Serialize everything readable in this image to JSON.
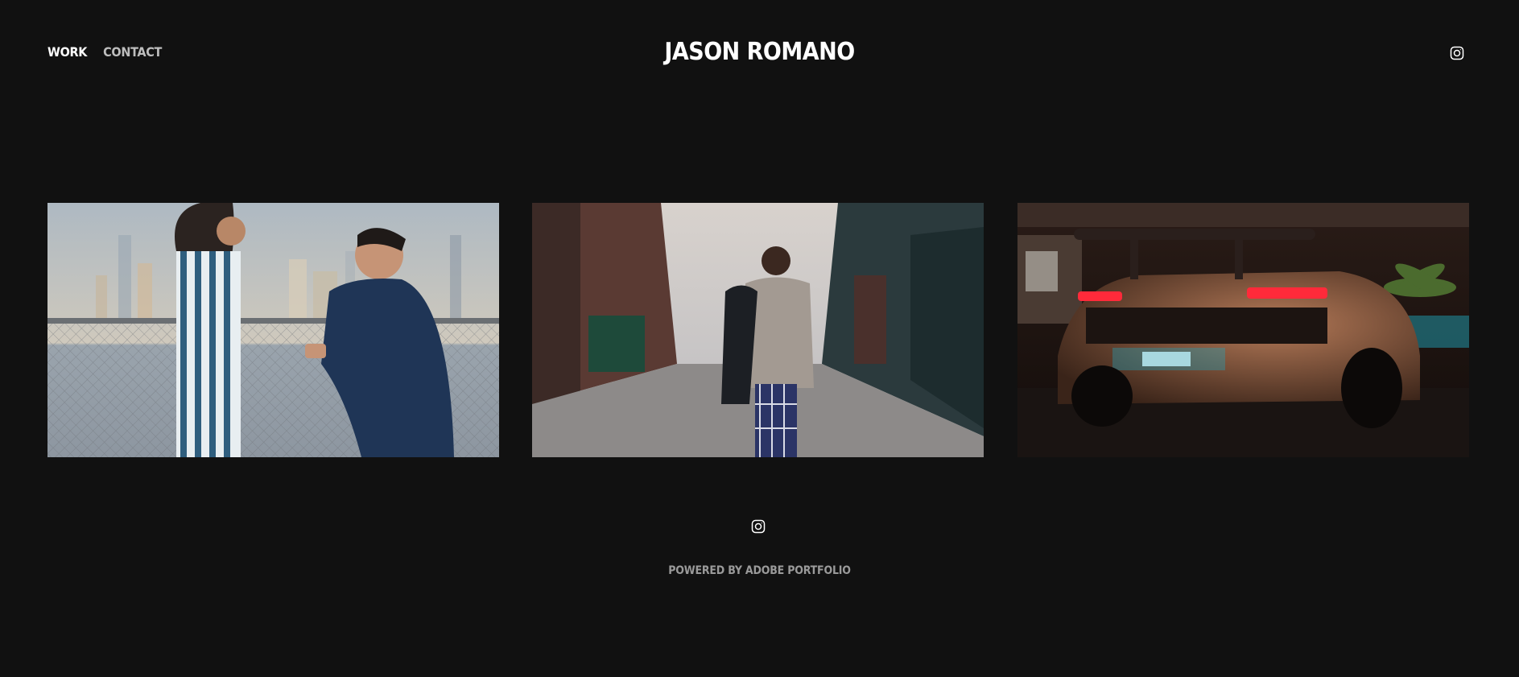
{
  "header": {
    "nav": [
      {
        "label": "WORK",
        "active": true
      },
      {
        "label": "CONTACT",
        "active": false
      }
    ],
    "site_title": "JASON ROMANO",
    "social_icon": "instagram-icon"
  },
  "gallery": {
    "projects": [
      {
        "subject": "proposal-photo"
      },
      {
        "subject": "street-portrait-photo"
      },
      {
        "subject": "sports-car-photo"
      }
    ]
  },
  "footer": {
    "social_icon": "instagram-icon",
    "powered_by": "POWERED BY ADOBE PORTFOLIO"
  },
  "colors": {
    "background": "#111111",
    "nav_active": "#ffffff",
    "nav_inactive": "#bdbdbd",
    "footer_text": "#9a9a9a"
  }
}
